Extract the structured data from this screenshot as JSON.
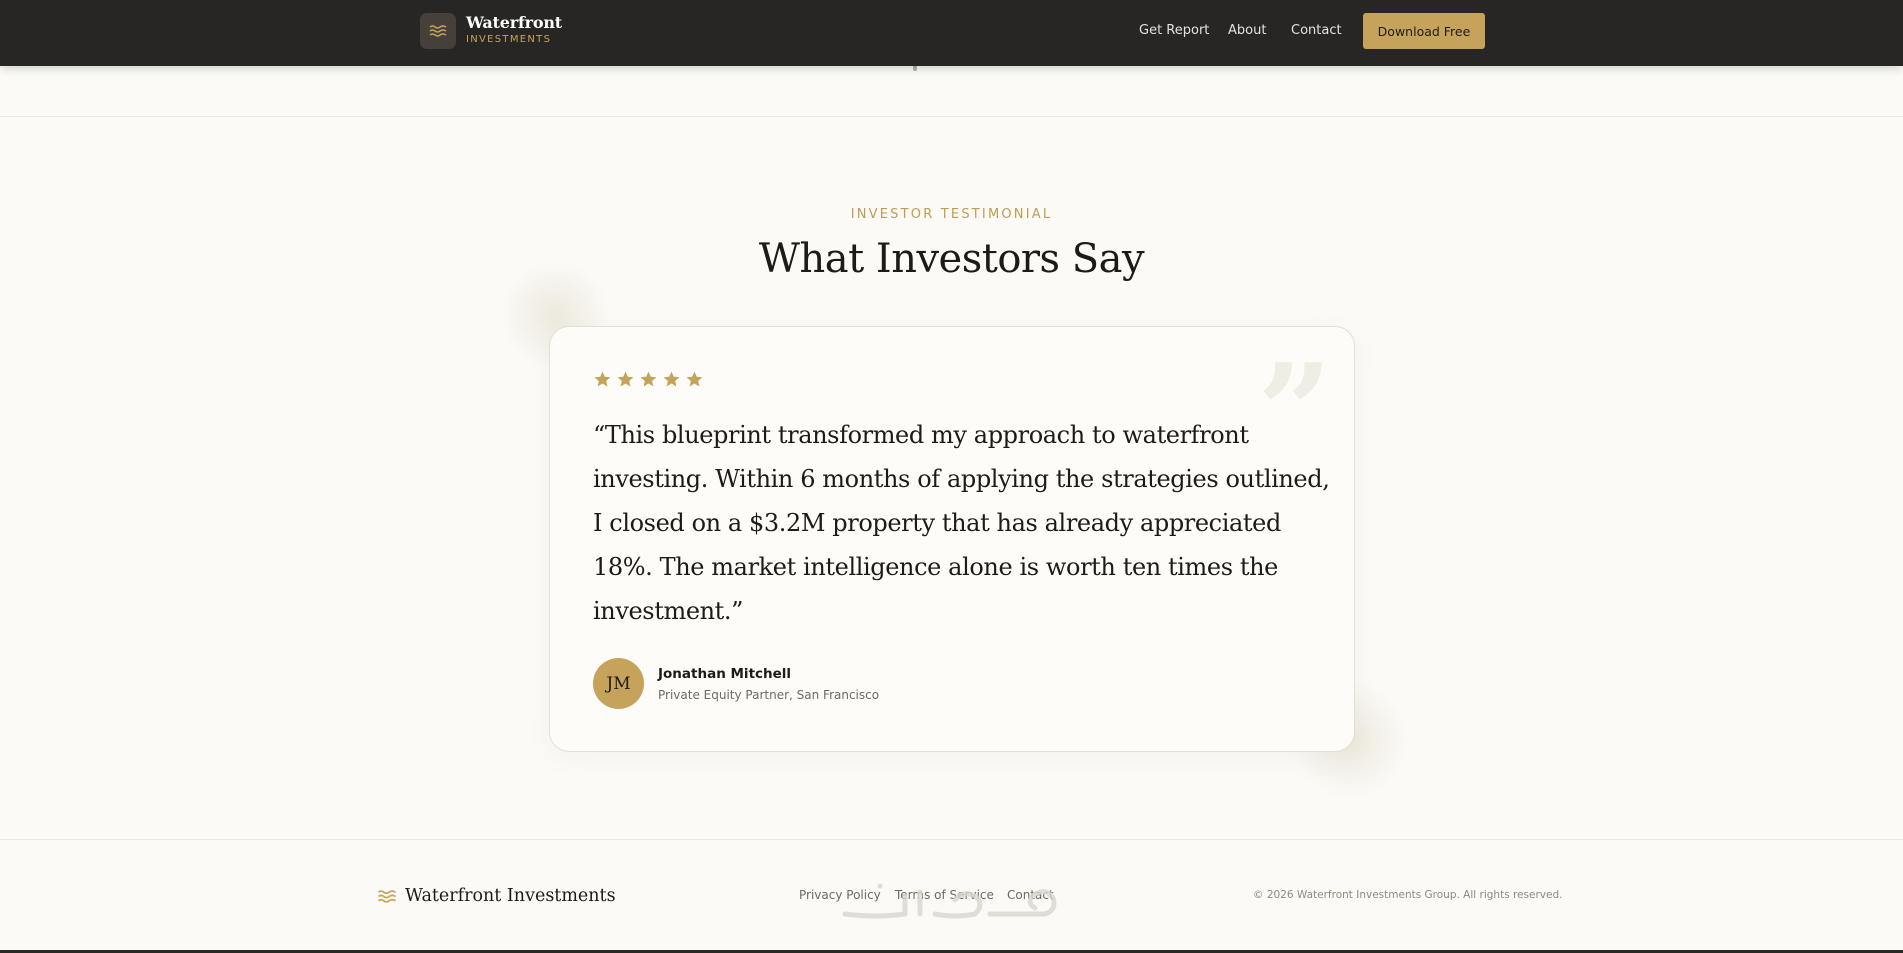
{
  "header": {
    "brand_name": "Waterfront",
    "brand_sub": "INVESTMENTS",
    "logo_icon": "waves-icon",
    "nav": [
      "Get Report",
      "About",
      "Contact"
    ],
    "cta_label": "Download Free"
  },
  "testimonial": {
    "eyebrow": "INVESTOR TESTIMONIAL",
    "title": "What Investors Say",
    "rating": 5,
    "rating_max": 5,
    "quote": "“This blueprint transformed my approach to waterfront investing. Within 6 months of applying the strategies outlined, I closed on a $3.2M property that has already appreciated 18%. The market intelligence alone is worth ten times the investment.”",
    "quote_icon": "quote-mark-icon",
    "avatar_initials": "JM",
    "author_name": "Jonathan Mitchell",
    "author_role": "Private Equity Partner, San Francisco"
  },
  "footer": {
    "brand_name": "Waterfront Investments",
    "links": [
      "Privacy Policy",
      "Terms of Service",
      "Contact"
    ],
    "copyright": "© 2026 Waterfront Investments Group. All rights reserved."
  },
  "colors": {
    "accent": "#c6a35b",
    "header_bg": "#272624",
    "page_bg": "#fbfaf6",
    "text": "#1d1b17"
  }
}
